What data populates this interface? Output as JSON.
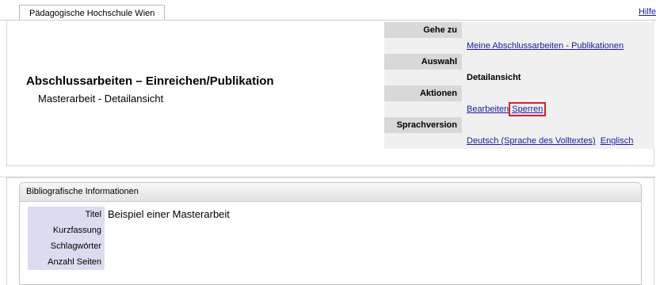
{
  "tab": {
    "label": "Pädagogische Hochschule Wien"
  },
  "help": {
    "label": "Hilfe"
  },
  "header": {
    "title": "Abschlussarbeiten – Einreichen/Publikation",
    "subtitle": "Masterarbeit - Detailansicht"
  },
  "nav": {
    "goto_label": "Gehe zu",
    "goto_link": "Meine Abschlussarbeiten - Publikationen",
    "auswahl_label": "Auswahl",
    "auswahl_value": "Detailansicht",
    "aktionen_label": "Aktionen",
    "action_edit": "Bearbeiten",
    "action_lock": "Sperren",
    "sprach_label": "Sprachversion",
    "lang_de": "Deutsch (Sprache des Volltextes)",
    "lang_en": "Englisch"
  },
  "bib": {
    "header": "Bibliografische Informationen",
    "rows": [
      {
        "label": "Titel",
        "value": "Beispiel einer Masterarbeit"
      },
      {
        "label": "Kurzfassung",
        "value": ""
      },
      {
        "label": "Schlagwörter",
        "value": ""
      },
      {
        "label": "Anzahl Seiten",
        "value": ""
      }
    ]
  },
  "colors": {
    "link": "#1a1aa6",
    "highlight": "#d3202b",
    "label_bg": "#dcdcf0"
  }
}
